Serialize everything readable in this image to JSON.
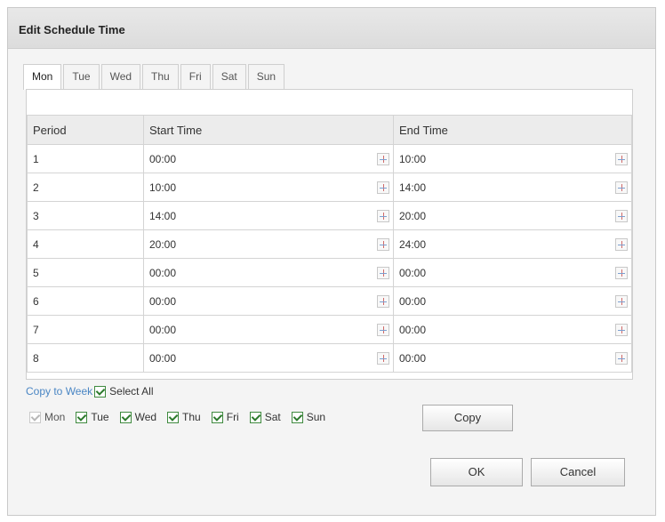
{
  "dialog": {
    "title": "Edit Schedule Time"
  },
  "tabs": [
    {
      "label": "Mon",
      "active": true
    },
    {
      "label": "Tue",
      "active": false
    },
    {
      "label": "Wed",
      "active": false
    },
    {
      "label": "Thu",
      "active": false
    },
    {
      "label": "Fri",
      "active": false
    },
    {
      "label": "Sat",
      "active": false
    },
    {
      "label": "Sun",
      "active": false
    }
  ],
  "table": {
    "headers": {
      "period": "Period",
      "start": "Start Time",
      "end": "End Time"
    },
    "rows": [
      {
        "period": "1",
        "start": "00:00",
        "end": "10:00"
      },
      {
        "period": "2",
        "start": "10:00",
        "end": "14:00"
      },
      {
        "period": "3",
        "start": "14:00",
        "end": "20:00"
      },
      {
        "period": "4",
        "start": "20:00",
        "end": "24:00"
      },
      {
        "period": "5",
        "start": "00:00",
        "end": "00:00"
      },
      {
        "period": "6",
        "start": "00:00",
        "end": "00:00"
      },
      {
        "period": "7",
        "start": "00:00",
        "end": "00:00"
      },
      {
        "period": "8",
        "start": "00:00",
        "end": "00:00"
      }
    ]
  },
  "copy": {
    "link_label": "Copy to Week",
    "select_all_label": "Select All",
    "select_all_checked": true,
    "days": [
      {
        "label": "Mon",
        "checked": true,
        "disabled": true
      },
      {
        "label": "Tue",
        "checked": true,
        "disabled": false
      },
      {
        "label": "Wed",
        "checked": true,
        "disabled": false
      },
      {
        "label": "Thu",
        "checked": true,
        "disabled": false
      },
      {
        "label": "Fri",
        "checked": true,
        "disabled": false
      },
      {
        "label": "Sat",
        "checked": true,
        "disabled": false
      },
      {
        "label": "Sun",
        "checked": true,
        "disabled": false
      }
    ],
    "button_label": "Copy"
  },
  "footer": {
    "ok_label": "OK",
    "cancel_label": "Cancel"
  },
  "icons": {
    "time_picker": "clock-icon"
  }
}
